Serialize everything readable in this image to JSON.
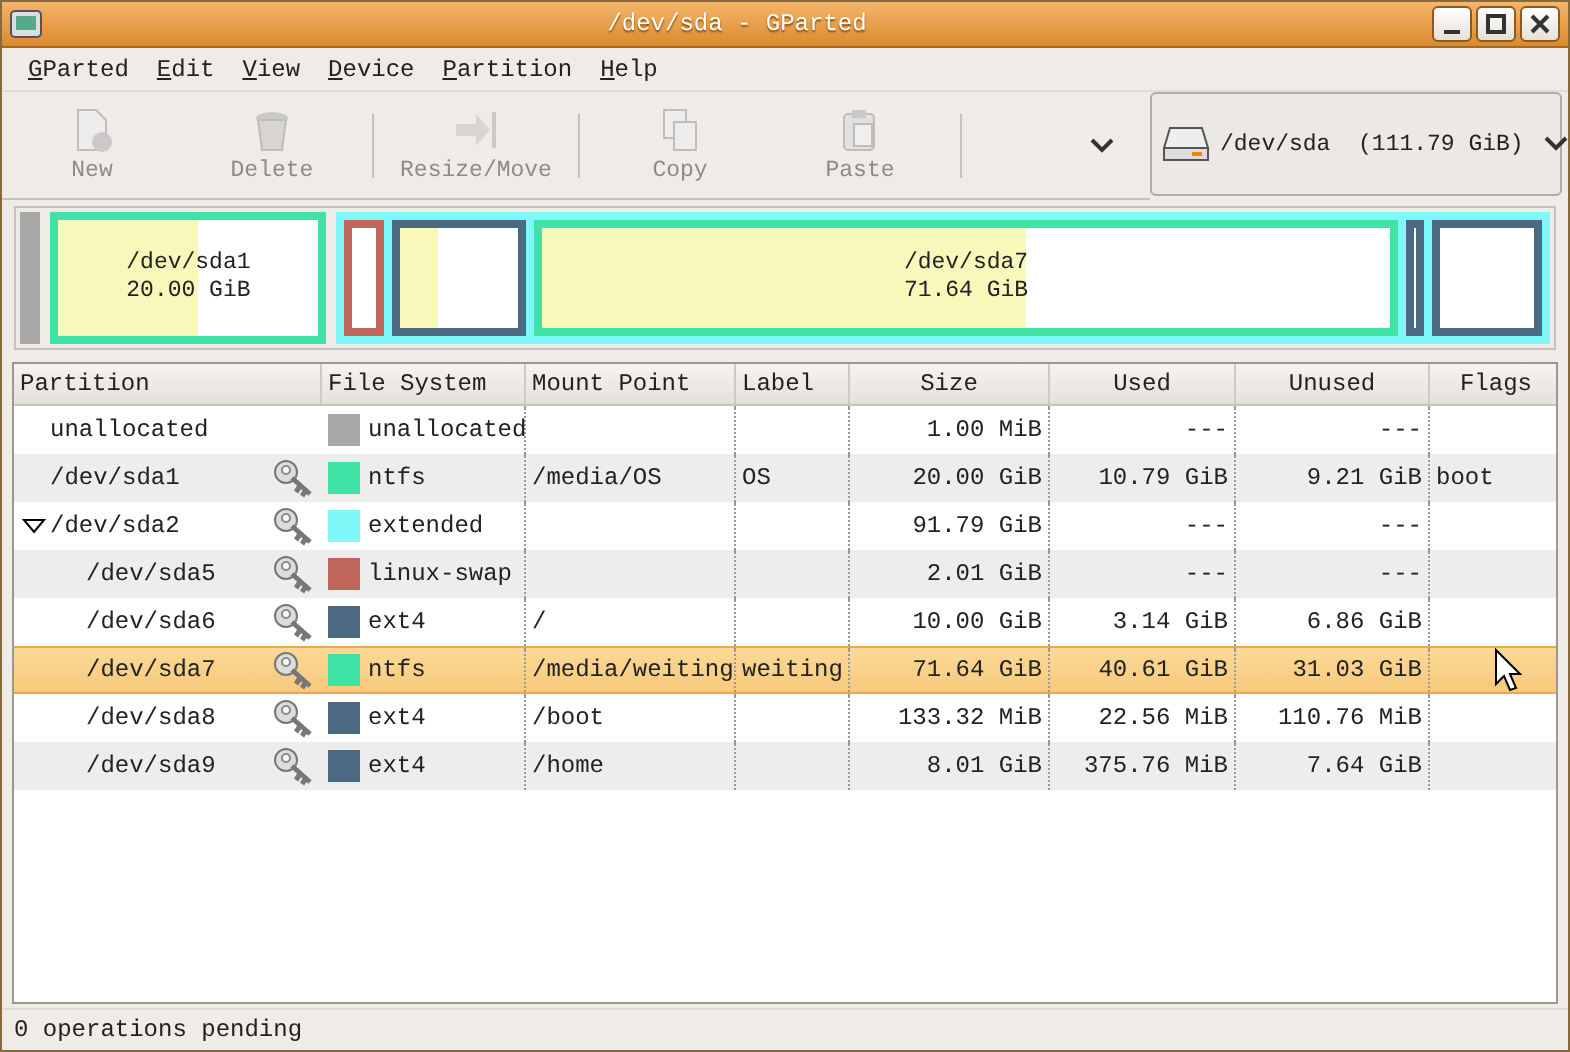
{
  "window": {
    "title": "/dev/sda - GParted"
  },
  "menu": [
    {
      "label": "GParted"
    },
    {
      "label": "Edit"
    },
    {
      "label": "View"
    },
    {
      "label": "Device"
    },
    {
      "label": "Partition"
    },
    {
      "label": "Help"
    }
  ],
  "toolbar": [
    {
      "label": "New",
      "kind": "new",
      "disabled": true
    },
    {
      "label": "Delete",
      "kind": "delete",
      "disabled": true
    },
    {
      "label": "Resize/Move",
      "kind": "resize",
      "disabled": true
    },
    {
      "label": "Copy",
      "kind": "copy",
      "disabled": true
    },
    {
      "label": "Paste",
      "kind": "paste",
      "disabled": true
    }
  ],
  "device": {
    "name": "/dev/sda",
    "size": "(111.79 GiB)"
  },
  "table": {
    "columns": [
      "Partition",
      "File System",
      "Mount Point",
      "Label",
      "Size",
      "Used",
      "Unused",
      "Flags"
    ],
    "rows": [
      {
        "partition": "unallocated",
        "busy": false,
        "color": "#a9a9a9",
        "fs": "unallocated",
        "size": "1.00 MiB",
        "used": "---",
        "unused": "---",
        "selected": false
      },
      {
        "partition": "/dev/sda1",
        "busy": true,
        "color": "#3fe3a6",
        "fs": "ntfs",
        "mount": "/media/OS",
        "label": "OS",
        "size": "20.00 GiB",
        "used": "10.79 GiB",
        "unused": "9.21 GiB",
        "flags": "boot",
        "selected": false,
        "level": 0.54,
        "map_text": {
          "name": "/dev/sda1",
          "size": "20.00 GiB"
        }
      },
      {
        "partition": "/dev/sda2",
        "busy": true,
        "color": "#7ef8f8",
        "fs": "extended",
        "size": "91.79 GiB",
        "used": "---",
        "unused": "---",
        "selected": false,
        "expanded": true,
        "children": [
          {
            "partition": "/dev/sda5",
            "busy": true,
            "color": "#c1665a",
            "fs": "linux-swap",
            "size": "2.01 GiB",
            "used": "---",
            "unused": "---",
            "selected": false
          },
          {
            "partition": "/dev/sda6",
            "busy": true,
            "color": "#4b6983",
            "fs": "ext4",
            "mount": "/",
            "size": "10.00 GiB",
            "used": "3.14 GiB",
            "unused": "6.86 GiB",
            "selected": false,
            "level": 0.31
          },
          {
            "partition": "/dev/sda7",
            "busy": true,
            "color": "#3fe3a6",
            "fs": "ntfs",
            "mount": "/media/weiting",
            "label": "weiting",
            "size": "71.64 GiB",
            "used": "40.61 GiB",
            "unused": "31.03 GiB",
            "selected": true,
            "level": 0.57,
            "map_text": {
              "name": "/dev/sda7",
              "size": "71.64 GiB"
            }
          },
          {
            "partition": "/dev/sda8",
            "busy": true,
            "color": "#4b6983",
            "fs": "ext4",
            "mount": "/boot",
            "size": "133.32 MiB",
            "used": "22.56 MiB",
            "unused": "110.76 MiB",
            "selected": false
          },
          {
            "partition": "/dev/sda9",
            "busy": true,
            "color": "#4b6983",
            "fs": "ext4",
            "mount": "/home",
            "size": "8.01 GiB",
            "used": "375.76 MiB",
            "unused": "7.64 GiB",
            "selected": false
          }
        ]
      }
    ]
  },
  "status_bar": "0 operations pending"
}
